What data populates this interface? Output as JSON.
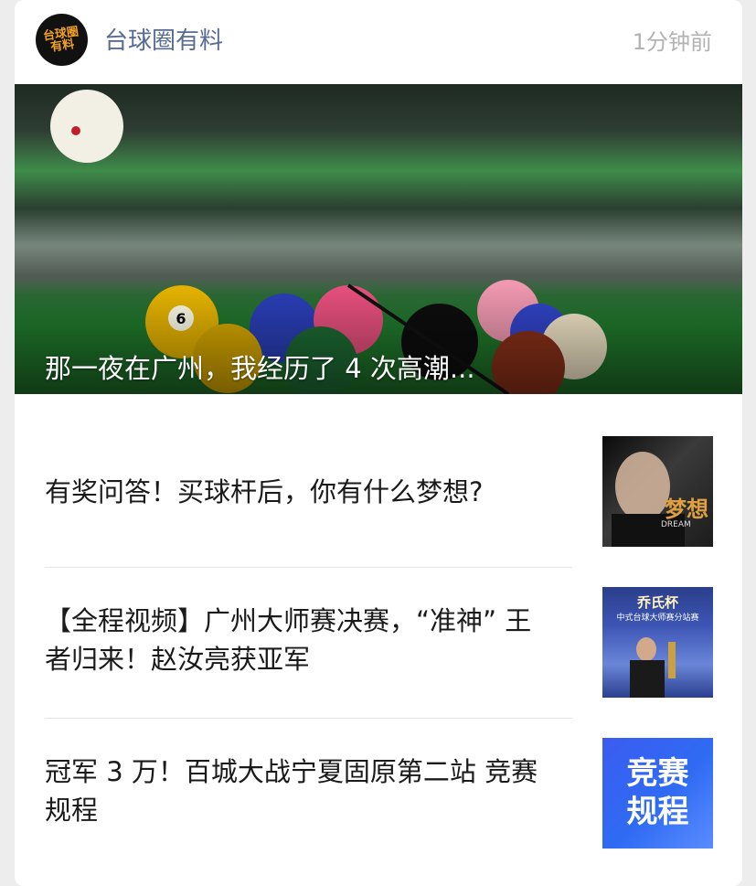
{
  "header": {
    "avatar_text": "台球圈\n有料",
    "account_name": "台球圈有料",
    "time": "1分钟前"
  },
  "cover": {
    "title": "那一夜在广州，我经历了 4 次高潮...",
    "ball_number": "6"
  },
  "articles": [
    {
      "title": "有奖问答！买球杆后，你有什么梦想?",
      "thumb_text": "梦想",
      "thumb_subtext": "DREAM"
    },
    {
      "title": "【全程视频】广州大师赛决赛，“准神” 王者归来！赵汝亮获亚军",
      "thumb_text": "乔氏杯",
      "thumb_subtext": "中式台球大师赛分站赛"
    },
    {
      "title": "冠军 3 万！百城大战宁夏固原第二站 竞赛规程",
      "thumb_text_line1": "竞赛",
      "thumb_text_line2": "规程"
    }
  ],
  "colors": {
    "account_name": "#576b95",
    "time": "#b2b2b2",
    "title": "#1a1a1a"
  }
}
